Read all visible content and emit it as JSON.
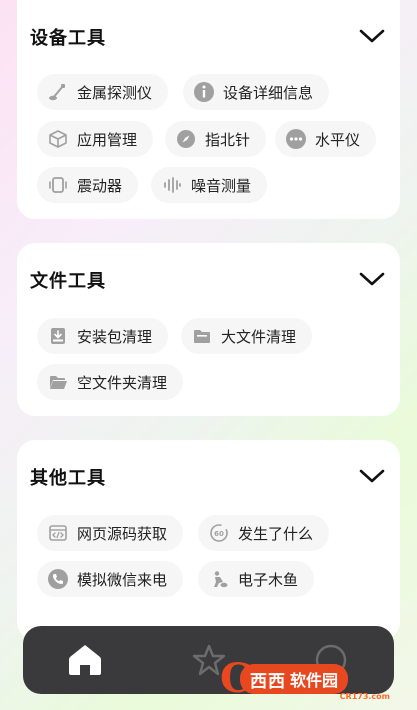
{
  "sections": [
    {
      "title": "设备工具",
      "items": [
        {
          "label": "金属探测仪",
          "icon": "metal-detector-icon"
        },
        {
          "label": "设备详细信息",
          "icon": "info-icon"
        },
        {
          "label": "应用管理",
          "icon": "cube-icon"
        },
        {
          "label": "指北针",
          "icon": "compass-icon"
        },
        {
          "label": "水平仪",
          "icon": "level-icon"
        },
        {
          "label": "震动器",
          "icon": "vibrate-icon"
        },
        {
          "label": "噪音测量",
          "icon": "sound-wave-icon"
        }
      ]
    },
    {
      "title": "文件工具",
      "items": [
        {
          "label": "安装包清理",
          "icon": "package-icon"
        },
        {
          "label": "大文件清理",
          "icon": "folder-icon"
        },
        {
          "label": "空文件夹清理",
          "icon": "open-folder-icon"
        }
      ]
    },
    {
      "title": "其他工具",
      "items": [
        {
          "label": "网页源码获取",
          "icon": "code-window-icon"
        },
        {
          "label": "发生了什么",
          "icon": "history-60-icon"
        },
        {
          "label": "模拟微信来电",
          "icon": "phone-icon"
        },
        {
          "label": "电子木鱼",
          "icon": "wooden-fish-icon"
        }
      ]
    }
  ],
  "watermark": {
    "brand": "西西",
    "name": "软件园",
    "site": "CR173.com"
  },
  "colors": {
    "nav_bg": "#3a3a3c",
    "chip_bg": "#f6f6f6",
    "icon_gray": "#9a9a9a",
    "watermark": "#e8481f"
  }
}
